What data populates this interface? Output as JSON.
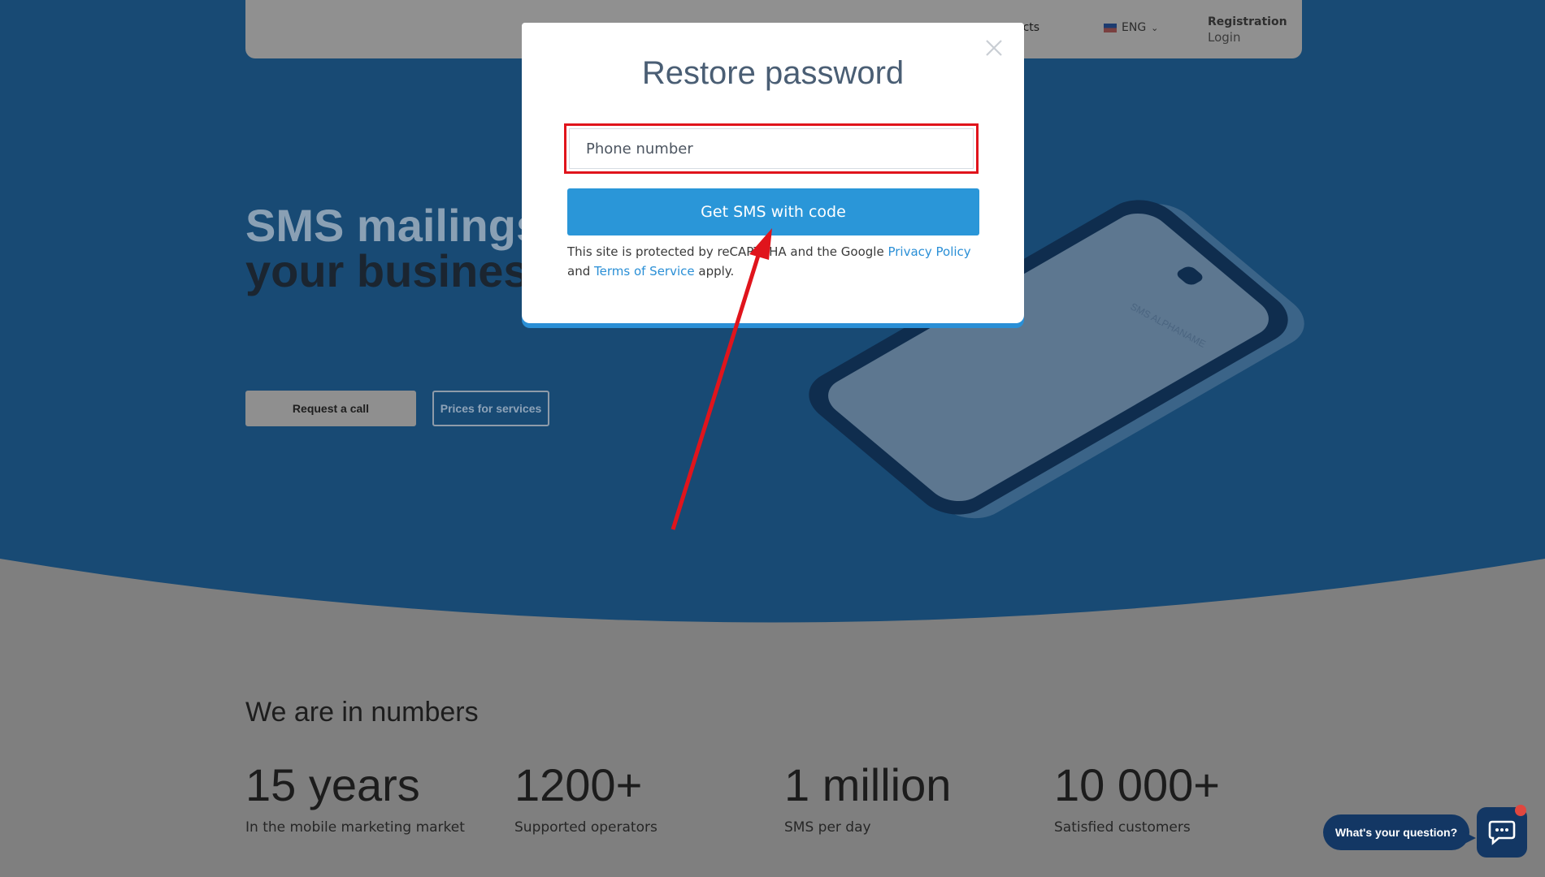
{
  "header": {
    "contacts_label": "acts",
    "language_label": "ENG",
    "registration_label": "Registration",
    "login_label": "Login"
  },
  "hero": {
    "title_line1": "SMS mailings",
    "title_line2": "your business",
    "request_call_label": "Request a call",
    "prices_label": "Prices for services",
    "phone_screen_text": "SMS ALPHANAME"
  },
  "numbers": {
    "title": "We are in numbers",
    "stats": [
      {
        "value": "15 years",
        "label": "In the mobile marketing market"
      },
      {
        "value": "1200+",
        "label": "Supported operators"
      },
      {
        "value": "1 million",
        "label": "SMS per day"
      },
      {
        "value": "10 000+",
        "label": "Satisfied customers"
      }
    ]
  },
  "modal": {
    "title": "Restore password",
    "phone_placeholder": "Phone number",
    "phone_value": "",
    "submit_label": "Get SMS with code",
    "recaptcha_text_1": "This site is protected by reCAPTCHA and the Google ",
    "privacy_link": "Privacy Policy",
    "recaptcha_text_2": " and ",
    "terms_link": "Terms of Service",
    "recaptcha_text_3": " apply."
  },
  "chat": {
    "bubble_label": "What's your question?",
    "icon": "chat-icon"
  },
  "colors": {
    "hero_bg": "#184a74",
    "overlay_gray": "#7f7f7f",
    "primary_button": "#2a96d8",
    "highlight_red": "#e0141c",
    "chat_navy": "#133764"
  }
}
